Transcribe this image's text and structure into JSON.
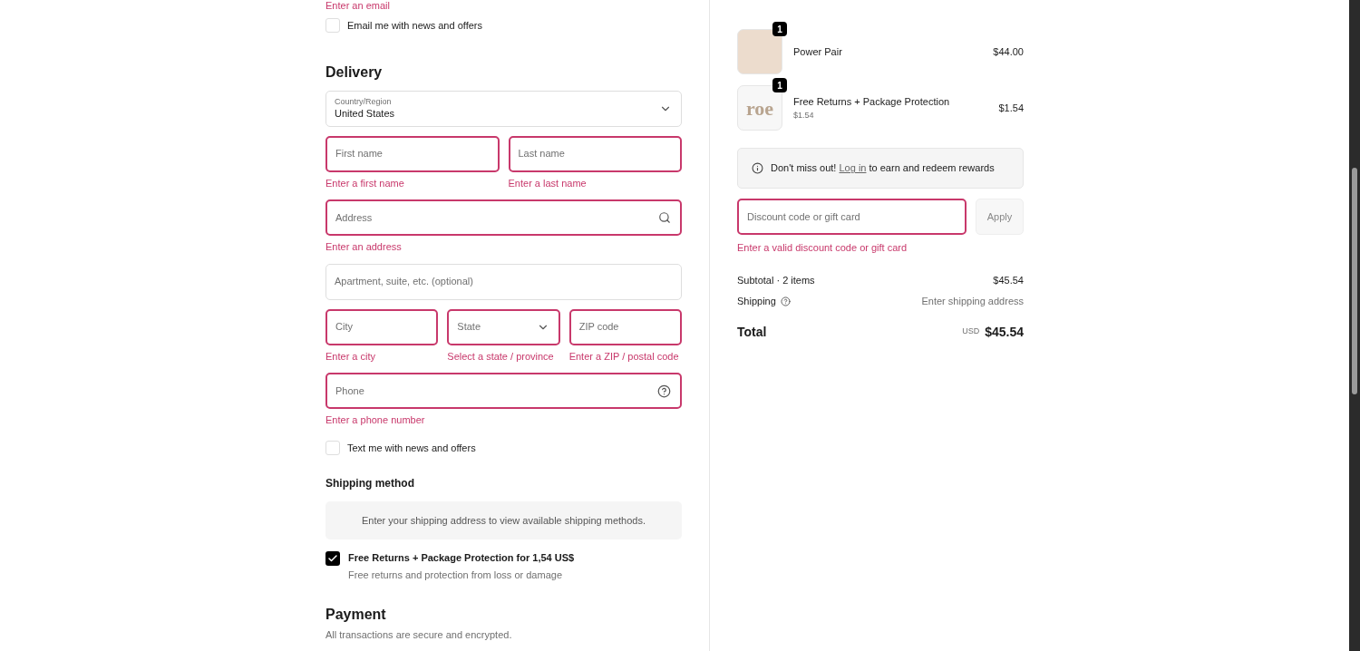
{
  "contact": {
    "error": "Enter an email",
    "newsletter": {
      "label": "Email me with news and offers",
      "checked": false
    }
  },
  "delivery": {
    "title": "Delivery",
    "country": {
      "label": "Country/Region",
      "value": "United States"
    },
    "fields": [
      {
        "row": [
          {
            "kind": "text",
            "placeholder": "First name",
            "error": "Enter a first name"
          },
          {
            "kind": "text",
            "placeholder": "Last name",
            "error": "Enter a last name"
          }
        ]
      },
      {
        "row": [
          {
            "kind": "search",
            "placeholder": "Address",
            "error": "Enter an address"
          }
        ]
      },
      {
        "row": [
          {
            "kind": "text",
            "placeholder": "Apartment, suite, etc. (optional)"
          }
        ]
      },
      {
        "row": [
          {
            "kind": "text",
            "placeholder": "City",
            "error": "Enter a city"
          },
          {
            "kind": "select",
            "placeholder": "State",
            "error": "Select a state / province"
          },
          {
            "kind": "text",
            "placeholder": "ZIP code",
            "error": "Enter a ZIP / postal code"
          }
        ]
      },
      {
        "row": [
          {
            "kind": "help",
            "placeholder": "Phone",
            "error": "Enter a phone number"
          }
        ]
      }
    ],
    "sms": {
      "label": "Text me with news and offers",
      "checked": false
    }
  },
  "shipping_method": {
    "title": "Shipping method",
    "notice": "Enter your shipping address to view available shipping methods.",
    "protection": {
      "label": "Free Returns + Package Protection for 1,54 US$",
      "description": "Free returns and protection from loss or damage",
      "checked": true
    }
  },
  "payment": {
    "title": "Payment",
    "subtitle": "All transactions are secure and encrypted."
  },
  "cart": {
    "items": [
      {
        "kind": "product",
        "name": "Power Pair",
        "quantity": "1",
        "price": "$44.00"
      },
      {
        "kind": "logo",
        "name": "Free Returns + Package Protection",
        "logo_text": "roe",
        "unit_price": "$1.54",
        "quantity": "1",
        "price": "$1.54"
      }
    ],
    "rewards": {
      "before": "Don't miss out!",
      "link": "Log in",
      "after": "to earn and redeem rewards"
    },
    "discount": {
      "placeholder": "Discount code or gift card",
      "button": "Apply",
      "error": "Enter a valid discount code or gift card"
    },
    "subtotal": {
      "label": "Subtotal · 2 items",
      "value": "$45.54"
    },
    "shipping": {
      "label": "Shipping",
      "value": "Enter shipping address"
    },
    "total": {
      "label": "Total",
      "currency": "USD",
      "value": "$45.54"
    }
  }
}
